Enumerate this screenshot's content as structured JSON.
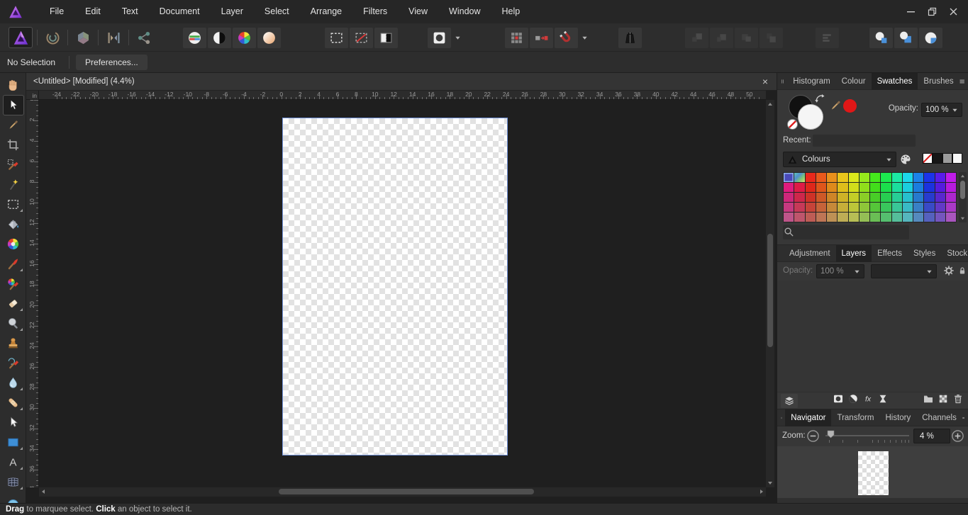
{
  "titlebar": {
    "menus": [
      "File",
      "Edit",
      "Text",
      "Document",
      "Layer",
      "Select",
      "Arrange",
      "Filters",
      "View",
      "Window",
      "Help"
    ],
    "window_controls": [
      "minimize",
      "restore",
      "close"
    ]
  },
  "toolbar": {
    "groups": [
      {
        "id": "personas",
        "separated": true,
        "items": [
          {
            "icon": "photo-persona",
            "selected": true
          },
          {
            "icon": "liquify-persona"
          },
          {
            "icon": "develop-persona"
          },
          {
            "icon": "tone-mapping-persona"
          },
          {
            "icon": "export-persona"
          }
        ]
      },
      {
        "id": "auto",
        "items": [
          {
            "icon": "auto-levels"
          },
          {
            "icon": "auto-contrast"
          },
          {
            "icon": "auto-colours"
          },
          {
            "icon": "auto-white-balance"
          }
        ]
      },
      {
        "id": "selmode",
        "items": [
          {
            "icon": "marquee-new"
          },
          {
            "icon": "marquee-subtract"
          },
          {
            "icon": "marquee-toggle"
          }
        ]
      },
      {
        "id": "assistant",
        "caret": true,
        "items": [
          {
            "icon": "assistant-preview"
          }
        ]
      },
      {
        "id": "snapping",
        "caret": true,
        "items": [
          {
            "icon": "pixel-grid"
          },
          {
            "icon": "force-pixel-alignment"
          },
          {
            "icon": "snapping-magnet"
          }
        ]
      },
      {
        "id": "manager",
        "items": [
          {
            "icon": "assistant-manager"
          }
        ]
      },
      {
        "id": "arrange",
        "items": [
          {
            "icon": "move-to-front",
            "disabled": true
          },
          {
            "icon": "move-forward",
            "disabled": true
          },
          {
            "icon": "move-backward",
            "disabled": true
          },
          {
            "icon": "move-to-back",
            "disabled": true
          }
        ]
      },
      {
        "id": "align",
        "items": [
          {
            "icon": "alignment",
            "disabled": true
          }
        ]
      },
      {
        "id": "insertion",
        "items": [
          {
            "icon": "insert-behind"
          },
          {
            "icon": "insert-on-top"
          },
          {
            "icon": "replace-selection"
          }
        ]
      }
    ]
  },
  "contextbar": {
    "status": "No Selection",
    "preferences_label": "Preferences..."
  },
  "document": {
    "tab_title": "<Untitled> [Modified] (4.4%)"
  },
  "rulers": {
    "unit": "in",
    "horizontal": {
      "start": -24,
      "end": 50,
      "step": 2
    },
    "vertical": {
      "start": 0,
      "end": 38,
      "step": 2
    }
  },
  "tools": [
    {
      "icon": "view-tool"
    },
    {
      "icon": "move-tool",
      "selected": true
    },
    {
      "icon": "colour-picker-tool"
    },
    {
      "icon": "crop-tool"
    },
    {
      "icon": "selection-brush-tool"
    },
    {
      "icon": "flood-select-tool"
    },
    {
      "icon": "marquee-select-tool",
      "flyout": true
    },
    {
      "icon": "flood-fill-tool"
    },
    {
      "icon": "gradient-tool"
    },
    {
      "icon": "paint-brush-tool",
      "flyout": true
    },
    {
      "icon": "colour-replacement-brush-tool"
    },
    {
      "icon": "erase-brush-tool",
      "flyout": true
    },
    {
      "icon": "dodge-brush-tool",
      "flyout": true
    },
    {
      "icon": "clone-brush-tool"
    },
    {
      "icon": "smudge-brush-tool"
    },
    {
      "icon": "blur-brush-tool",
      "flyout": true
    },
    {
      "icon": "healing-brush-tool",
      "flyout": true
    },
    {
      "icon": "node-tool"
    },
    {
      "icon": "rectangle-tool",
      "flyout": true
    },
    {
      "icon": "artistic-text-tool",
      "flyout": true
    },
    {
      "icon": "mesh-warp-tool",
      "flyout": true
    },
    {
      "icon": "ellipse-tool"
    }
  ],
  "swatches_panel": {
    "tabs": [
      "Histogram",
      "Colour",
      "Swatches",
      "Brushes"
    ],
    "active_tab": "Swatches",
    "opacity_label": "Opacity:",
    "opacity_value": "100 %",
    "recent_label": "Recent:",
    "palette_name": "Colours",
    "fill_colour": "#f5f5f5",
    "stroke_colour": "#111111",
    "picked_colour": "#e01717",
    "quick_swatches": [
      {
        "name": "none"
      },
      {
        "name": "black",
        "color": "#161616"
      },
      {
        "name": "grey",
        "color": "#9b9b9b"
      },
      {
        "name": "white",
        "color": "#f8f8f8"
      }
    ],
    "grid": {
      "cols": 16,
      "rows": 5,
      "hues": [
        330,
        347,
        4,
        18,
        34,
        50,
        64,
        84,
        108,
        135,
        160,
        185,
        210,
        233,
        258,
        288
      ],
      "row_saturation": [
        82,
        78,
        68,
        55,
        45
      ],
      "row_lightness": [
        51,
        49,
        48,
        50,
        54
      ],
      "selected_cell": {
        "row": 0,
        "col": 0,
        "color": "#4a4ab8"
      },
      "gradient_cell": {
        "row": 0,
        "col": 1,
        "colors": [
          "#63c7b2",
          "#4f8fd0",
          "#7cc576",
          "#d8e06b"
        ]
      }
    }
  },
  "layers_panel": {
    "tabs": [
      "Adjustment",
      "Layers",
      "Effects",
      "Styles",
      "Stock"
    ],
    "active_tab": "Layers",
    "opacity_label": "Opacity:",
    "opacity_value": "100 %",
    "blend_value": "",
    "bottom_icons_left": [
      "layers-stack"
    ],
    "bottom_icons_mid": [
      "mask",
      "adjustment",
      "fx",
      "live-filter"
    ],
    "bottom_icons_right": [
      "group-folder",
      "new-pixel-layer",
      "delete-trash"
    ]
  },
  "navigator_panel": {
    "tabs": [
      "Navigator",
      "Transform",
      "History",
      "Channels"
    ],
    "active_tab": "Navigator",
    "zoom_label": "Zoom:",
    "zoom_value": "4 %",
    "slider_ticks_pct": [
      4,
      20,
      38,
      56,
      63,
      70,
      77,
      84,
      91,
      95,
      99
    ]
  },
  "statusbar": {
    "bold1": "Drag",
    "text1": " to marquee select. ",
    "bold2": "Click",
    "text2": " an object to select it."
  },
  "colors": {
    "titlebar": "#262626",
    "toolbar": "#2d2d2d",
    "panel": "#373737",
    "panel_tabbar": "#2e2e2e",
    "canvas": "#1f1f1f",
    "page_border": "#7091d8",
    "accent_red": "#e01717"
  }
}
